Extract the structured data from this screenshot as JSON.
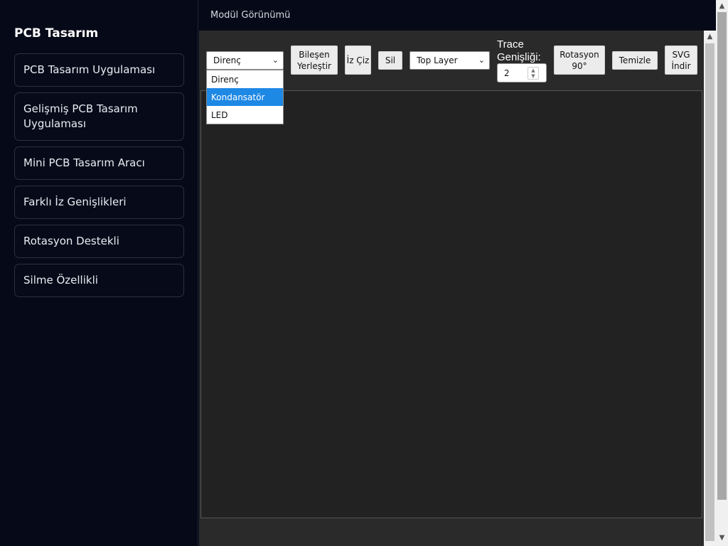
{
  "sidebar": {
    "title": "PCB Tasarım",
    "items": [
      {
        "label": "PCB Tasarım Uygulaması"
      },
      {
        "label": "Gelişmiş PCB Tasarım Uygulaması"
      },
      {
        "label": "Mini PCB Tasarım Aracı"
      },
      {
        "label": "Farklı İz Genişlikleri"
      },
      {
        "label": "Rotasyon Destekli"
      },
      {
        "label": "Silme Özellikli"
      }
    ]
  },
  "topbar": {
    "title": "Modül Görünümü"
  },
  "toolbar": {
    "component_select": {
      "value": "Direnç",
      "options": [
        "Direnç",
        "Kondansatör",
        "LED"
      ],
      "highlighted": "Kondansatör"
    },
    "place_button": "Bileşen Yerleştir",
    "draw_button": "İz Çiz",
    "delete_button": "Sil",
    "layer_select": {
      "value": "Top Layer"
    },
    "trace_label": "Trace Genişliği:",
    "trace_width": "2",
    "rotate_button": "Rotasyon 90°",
    "clear_button": "Temizle",
    "svg_button": "SVG İndir"
  },
  "colors": {
    "page_bg": "#060a18",
    "frame_bg": "#2a2a2a",
    "canvas_bg": "#222222",
    "highlight": "#1e88e5"
  },
  "icons": {
    "chevron": "chevron-down-icon",
    "scroll_up": "scroll-up-icon",
    "scroll_down": "scroll-down-icon"
  }
}
